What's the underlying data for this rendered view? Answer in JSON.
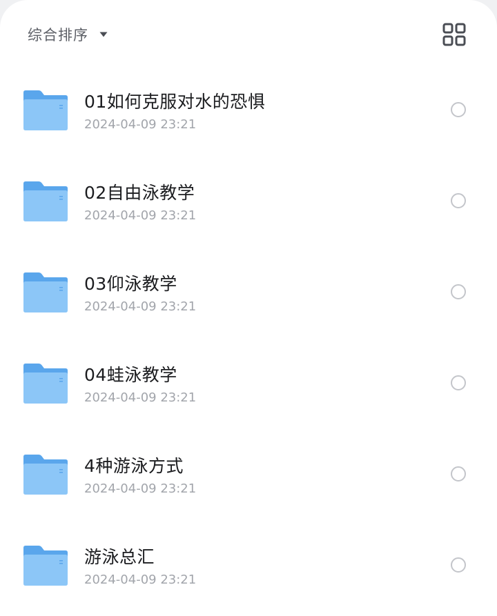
{
  "toolbar": {
    "sort_label": "综合排序",
    "sort_icon": "caret-down-icon",
    "view_icon": "grid-view-icon"
  },
  "colors": {
    "folder_back": "#5aa6ec",
    "folder_front": "#8cc6f7",
    "title_text": "#1b1c1f",
    "meta_text": "#a2a5ab",
    "radio_border": "#c3c5ca"
  },
  "files": [
    {
      "name": "01如何克服对水的恐惧",
      "date": "2024-04-09 23:21",
      "icon": "folder-icon"
    },
    {
      "name": "02自由泳教学",
      "date": "2024-04-09 23:21",
      "icon": "folder-icon"
    },
    {
      "name": "03仰泳教学",
      "date": "2024-04-09 23:21",
      "icon": "folder-icon"
    },
    {
      "name": "04蛙泳教学",
      "date": "2024-04-09 23:21",
      "icon": "folder-icon"
    },
    {
      "name": "4种游泳方式",
      "date": "2024-04-09 23:21",
      "icon": "folder-icon"
    },
    {
      "name": "游泳总汇",
      "date": "2024-04-09 23:21",
      "icon": "folder-icon"
    }
  ]
}
